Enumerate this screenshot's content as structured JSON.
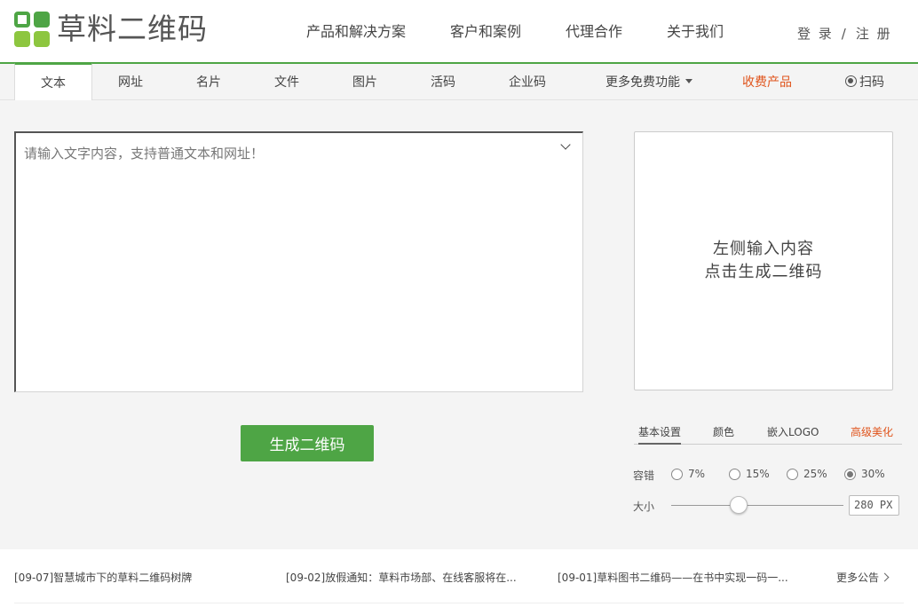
{
  "brand": {
    "name": "草料二维码",
    "colors": {
      "green": "#4ea545",
      "light_green": "#8dc63f",
      "orange": "#e0541c"
    }
  },
  "nav": {
    "items": [
      "产品和解决方案",
      "客户和案例",
      "代理合作",
      "关于我们"
    ],
    "login": "登 录",
    "separator": "/",
    "register": "注 册"
  },
  "tabs": {
    "items": [
      "文本",
      "网址",
      "名片",
      "文件",
      "图片",
      "活码",
      "企业码"
    ],
    "more": "更多免费功能",
    "paid": "收费产品",
    "scan": "扫码",
    "active_index": 0
  },
  "editor": {
    "placeholder": "请输入文字内容，支持普通文本和网址！",
    "value": ""
  },
  "generate_button": "生成二维码",
  "preview": {
    "line1": "左侧输入内容",
    "line2": "点击生成二维码"
  },
  "settings": {
    "tabs": [
      "基本设置",
      "颜色",
      "嵌入LOGO",
      "高级美化"
    ],
    "active_tab": 0,
    "error_label": "容错",
    "error_options": [
      "7%",
      "15%",
      "25%",
      "30%"
    ],
    "error_selected": "30%",
    "size_label": "大小",
    "size_value": "280 PX",
    "size_slider_fraction": 0.39
  },
  "footer": {
    "news": [
      "[09-07]智慧城市下的草料二维码树牌",
      "[09-02]放假通知：草料市场部、在线客服将在...",
      "[09-01]草料图书二维码——在书中实现一码一..."
    ],
    "more": "更多公告"
  }
}
